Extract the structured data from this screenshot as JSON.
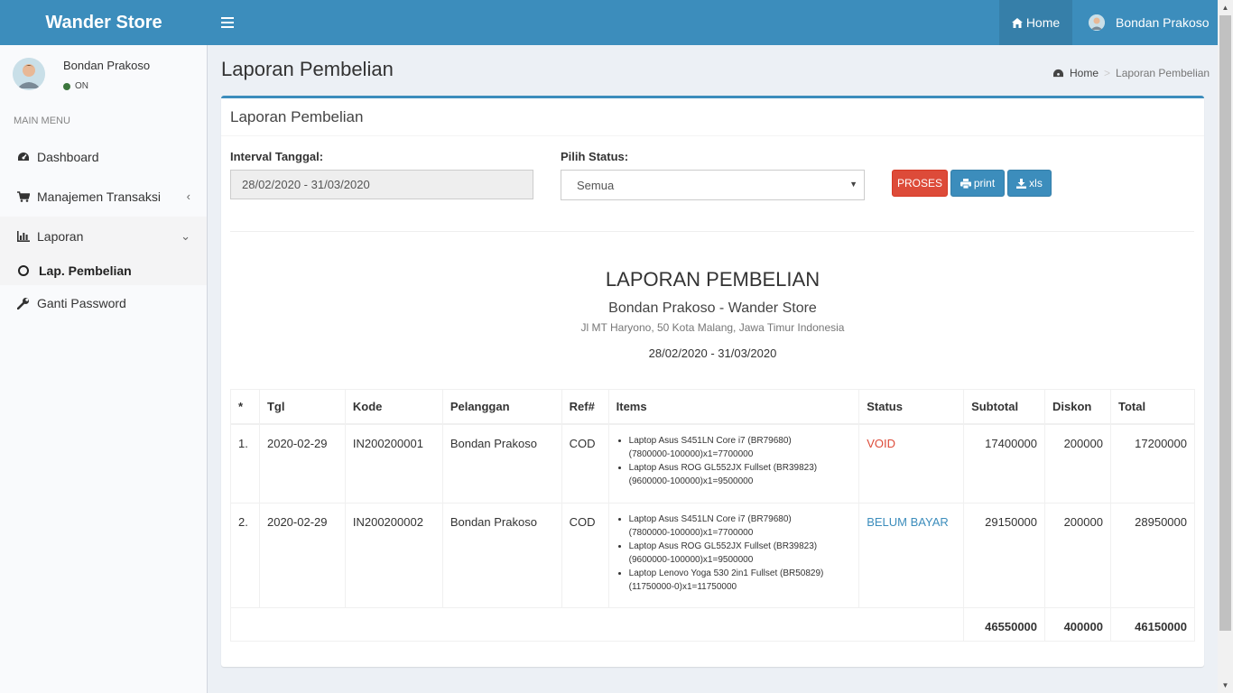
{
  "header": {
    "brand": "Wander Store",
    "nav_home": "Home",
    "user_name": "Bondan Prakoso"
  },
  "sidebar": {
    "user_name": "Bondan Prakoso",
    "status": "ON",
    "menu_header": "MAIN MENU",
    "items": [
      {
        "label": "Dashboard",
        "icon": "dashboard-icon"
      },
      {
        "label": "Manajemen Transaksi",
        "icon": "cart-icon"
      },
      {
        "label": "Laporan",
        "icon": "bar-chart-icon"
      },
      {
        "label": "Ganti Password",
        "icon": "wrench-icon"
      }
    ],
    "sub_item": "Lap. Pembelian"
  },
  "page": {
    "title": "Laporan Pembelian",
    "breadcrumb_home": "Home",
    "breadcrumb_current": "Laporan Pembelian"
  },
  "box": {
    "title": "Laporan Pembelian",
    "interval_label": "Interval Tanggal:",
    "interval_value": "28/02/2020 - 31/03/2020",
    "status_label": "Pilih Status:",
    "status_value": "Semua",
    "btn_proses": "PROSES",
    "btn_print": "print",
    "btn_xls": "xls"
  },
  "report": {
    "title": "LAPORAN PEMBELIAN",
    "subtitle": "Bondan Prakoso - Wander Store",
    "address": "Jl MT Haryono, 50 Kota Malang, Jawa Timur Indonesia",
    "date_range": "28/02/2020 - 31/03/2020",
    "columns": [
      "*",
      "Tgl",
      "Kode",
      "Pelanggan",
      "Ref#",
      "Items",
      "Status",
      "Subtotal",
      "Diskon",
      "Total"
    ],
    "rows": [
      {
        "no": "1.",
        "tgl": "2020-02-29",
        "kode": "IN200200001",
        "pelanggan": "Bondan Prakoso",
        "ref": "COD",
        "items": [
          "Laptop Asus S451LN Core i7 (BR79680)",
          "(7800000-100000)x1=7700000",
          "Laptop Asus ROG GL552JX Fullset (BR39823)",
          "(9600000-100000)x1=9500000"
        ],
        "status": "VOID",
        "subtotal": "17400000",
        "diskon": "200000",
        "total": "17200000"
      },
      {
        "no": "2.",
        "tgl": "2020-02-29",
        "kode": "IN200200002",
        "pelanggan": "Bondan Prakoso",
        "ref": "COD",
        "items": [
          "Laptop Asus S451LN Core i7 (BR79680)",
          "(7800000-100000)x1=7700000",
          "Laptop Asus ROG GL552JX Fullset (BR39823)",
          "(9600000-100000)x1=9500000",
          "Laptop Lenovo Yoga 530 2in1 Fullset (BR50829)",
          "(11750000-0)x1=11750000"
        ],
        "status": "BELUM BAYAR",
        "subtotal": "29150000",
        "diskon": "200000",
        "total": "28950000"
      }
    ],
    "totals": {
      "subtotal": "46550000",
      "diskon": "400000",
      "total": "46150000"
    }
  },
  "colors": {
    "primary": "#3c8dbc",
    "danger": "#dd4b39",
    "status_on": "#3c763d"
  }
}
